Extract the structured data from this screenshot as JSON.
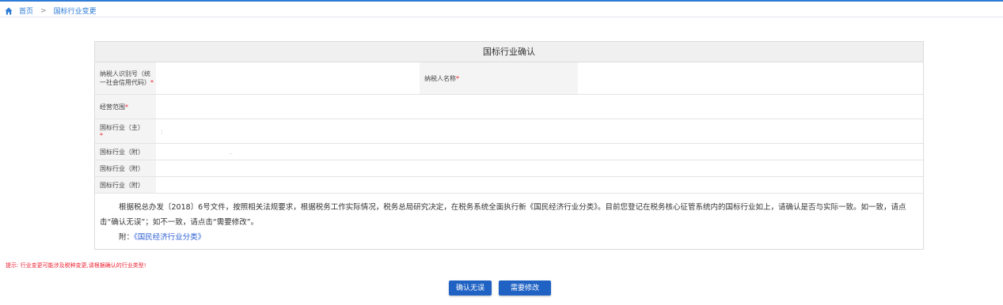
{
  "breadcrumb": {
    "home": "首页",
    "separator": ">",
    "current": "国标行业变更"
  },
  "panel": {
    "title": "国标行业确认"
  },
  "form": {
    "taxpayer_id_label": "纳税人识别号（统一社会信用代码）",
    "taxpayer_name_label": "纳税人名称",
    "business_scope_label": "经营范围",
    "industry_main_label": "国标行业（主）",
    "industry_main_value": ":",
    "industry_sub_label": "国标行业（附）",
    "industry_sub_value": "..",
    "required_mark": "*"
  },
  "notice": {
    "text": "根据税总办发〔2018〕6号文件，按照相关法规要求，根据税务工作实际情况，税务总局研究决定，在税务系统全面执行新《国民经济行业分类》。目前您登记在税务核心征管系统内的国标行业如上，请确认是否与实际一致。如一致，请点击“确认无误”；如不一致，请点击“需要修改”。",
    "attachment_prefix": "附：",
    "attachment_link": "《国民经济行业分类》"
  },
  "tip": "提示: 行业变更可能涉及税种变更,请根据确认的行业类型!",
  "buttons": {
    "confirm": "确认无误",
    "modify": "需要修改"
  },
  "colors": {
    "accent": "#2d7bd6",
    "button": "#1f62c4",
    "required": "#e23333"
  }
}
